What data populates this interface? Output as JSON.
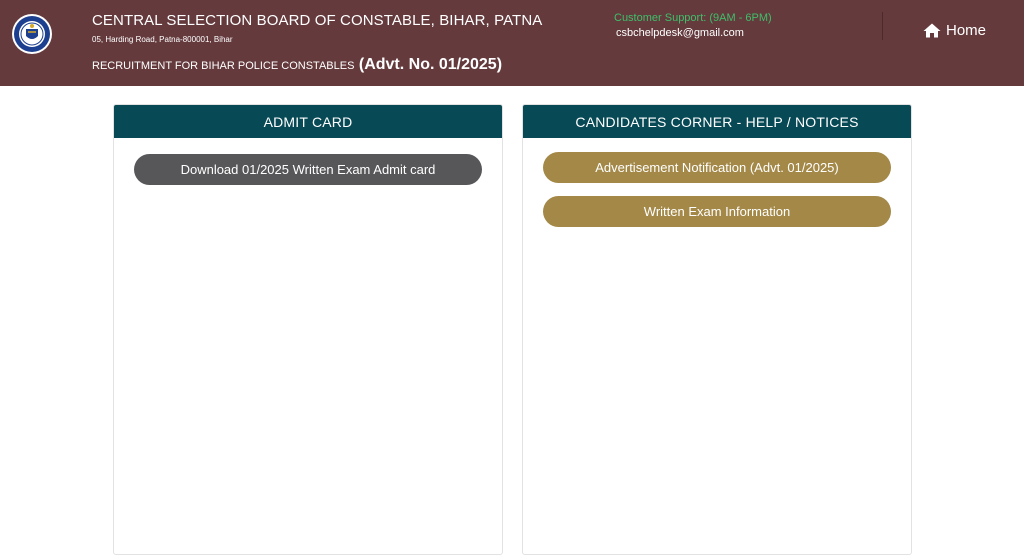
{
  "header": {
    "org_title": "CENTRAL SELECTION BOARD OF CONSTABLE, BIHAR, PATNA",
    "address": "05, Harding Road, Patna-800001, Bihar",
    "recruitment_text": "RECRUITMENT FOR BIHAR POLICE CONSTABLES",
    "advt_text": "(Advt. No. 01/2025)",
    "support_label": "Customer Support: (9AM - 6PM)",
    "support_email": "csbchelpdesk@gmail.com",
    "home_label": "Home",
    "logo_icon": "csbc-emblem-logo",
    "home_icon": "home-icon",
    "colors": {
      "header_bg": "#643a3d",
      "support_green": "#3fbf6a"
    }
  },
  "admit_card": {
    "title": "ADMIT CARD",
    "buttons": [
      {
        "label": "Download 01/2025 Written Exam Admit card"
      }
    ]
  },
  "candidates_corner": {
    "title": "CANDIDATES CORNER - HELP / NOTICES",
    "buttons": [
      {
        "label": "Advertisement Notification (Advt. 01/2025)"
      },
      {
        "label": "Written Exam Information"
      }
    ]
  },
  "colors": {
    "panel_header": "#074955",
    "grey_button": "#57575a",
    "gold_button": "#a38847"
  }
}
